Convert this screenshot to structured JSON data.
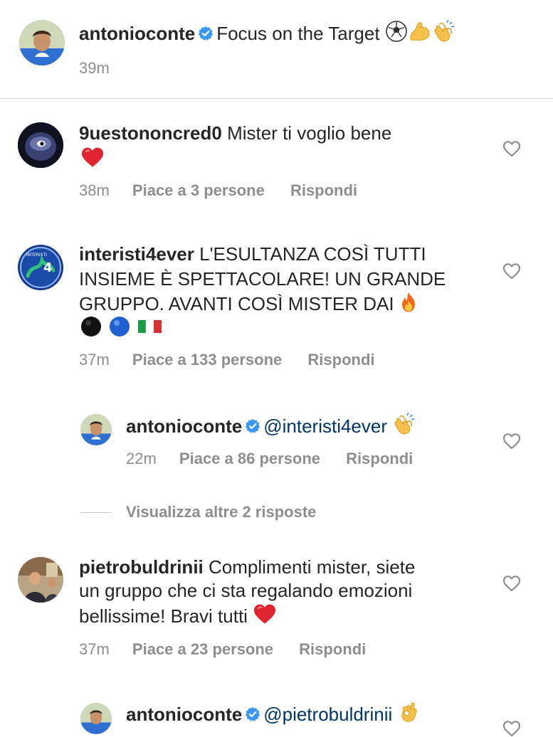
{
  "caption": {
    "username": "antonioconte",
    "text": "Focus on the Target",
    "emojis": [
      "soccer-ball-icon",
      "flexed-biceps-icon",
      "clapping-hands-icon"
    ],
    "time": "39m"
  },
  "comments": [
    {
      "username": "9uestononcred0",
      "text_line1": "Mister ti voglio bene",
      "time": "38m",
      "likes": "Piace a 3 persone",
      "reply": "Rispondi"
    },
    {
      "username": "interisti4ever",
      "text_line1": "L'ESULTANZA COSÌ TUTTI",
      "text_line2": "INSIEME È SPETTACOLARE! UN GRANDE",
      "text_line3": "GRUPPO. AVANTI COSÌ MISTER DAI",
      "time": "37m",
      "likes": "Piace a 133 persone",
      "reply": "Rispondi"
    },
    {
      "username": "antonioconte",
      "mention": "@interisti4ever",
      "time": "22m",
      "likes": "Piace a 86 persone",
      "reply": "Rispondi"
    },
    {
      "username": "pietrobuldrinii",
      "text_line1": "Complimenti mister, siete",
      "text_line2": "un gruppo che ci sta regalando emozioni",
      "text_line3": "bellissime! Bravi tutti",
      "time": "37m",
      "likes": "Piace a 23 persone",
      "reply": "Rispondi"
    },
    {
      "username": "antonioconte",
      "mention": "@pietrobuldrinii"
    }
  ],
  "view_more_replies": "Visualizza altre 2 risposte",
  "colors": {
    "verified": "#3897f0",
    "secondary_text": "#8e8e8e",
    "heart_red": "#ed2939",
    "divider": "#dbdbdb"
  }
}
